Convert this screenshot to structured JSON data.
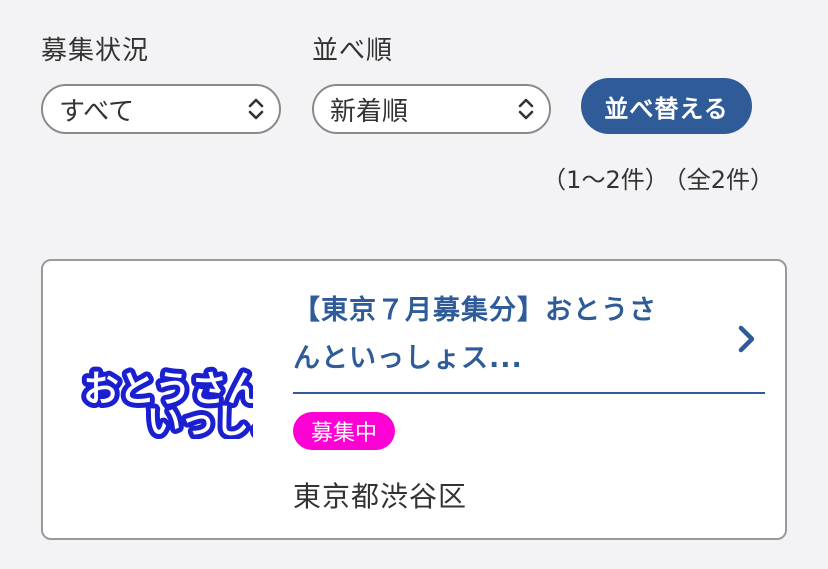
{
  "filters": {
    "status_label": "募集状況",
    "status_value": "すべて",
    "sort_label": "並べ順",
    "sort_value": "新着順",
    "sort_button": "並べ替える"
  },
  "results": {
    "range": "（1～2件）",
    "total": "（全2件）"
  },
  "listing": {
    "logo_text": "おとうさんといっしょ",
    "title_line1": "【東京７月募集分】おとうさ",
    "title_line2": "んといっしょス...",
    "status": "募集中",
    "location": "東京都渋谷区"
  },
  "colors": {
    "accent": "#2f5b99",
    "badge": "#ff00d4",
    "logo_blue": "#1a1fd0"
  },
  "icons": {
    "select_arrow": "up-down-chevron",
    "card_arrow": "chevron-right"
  }
}
